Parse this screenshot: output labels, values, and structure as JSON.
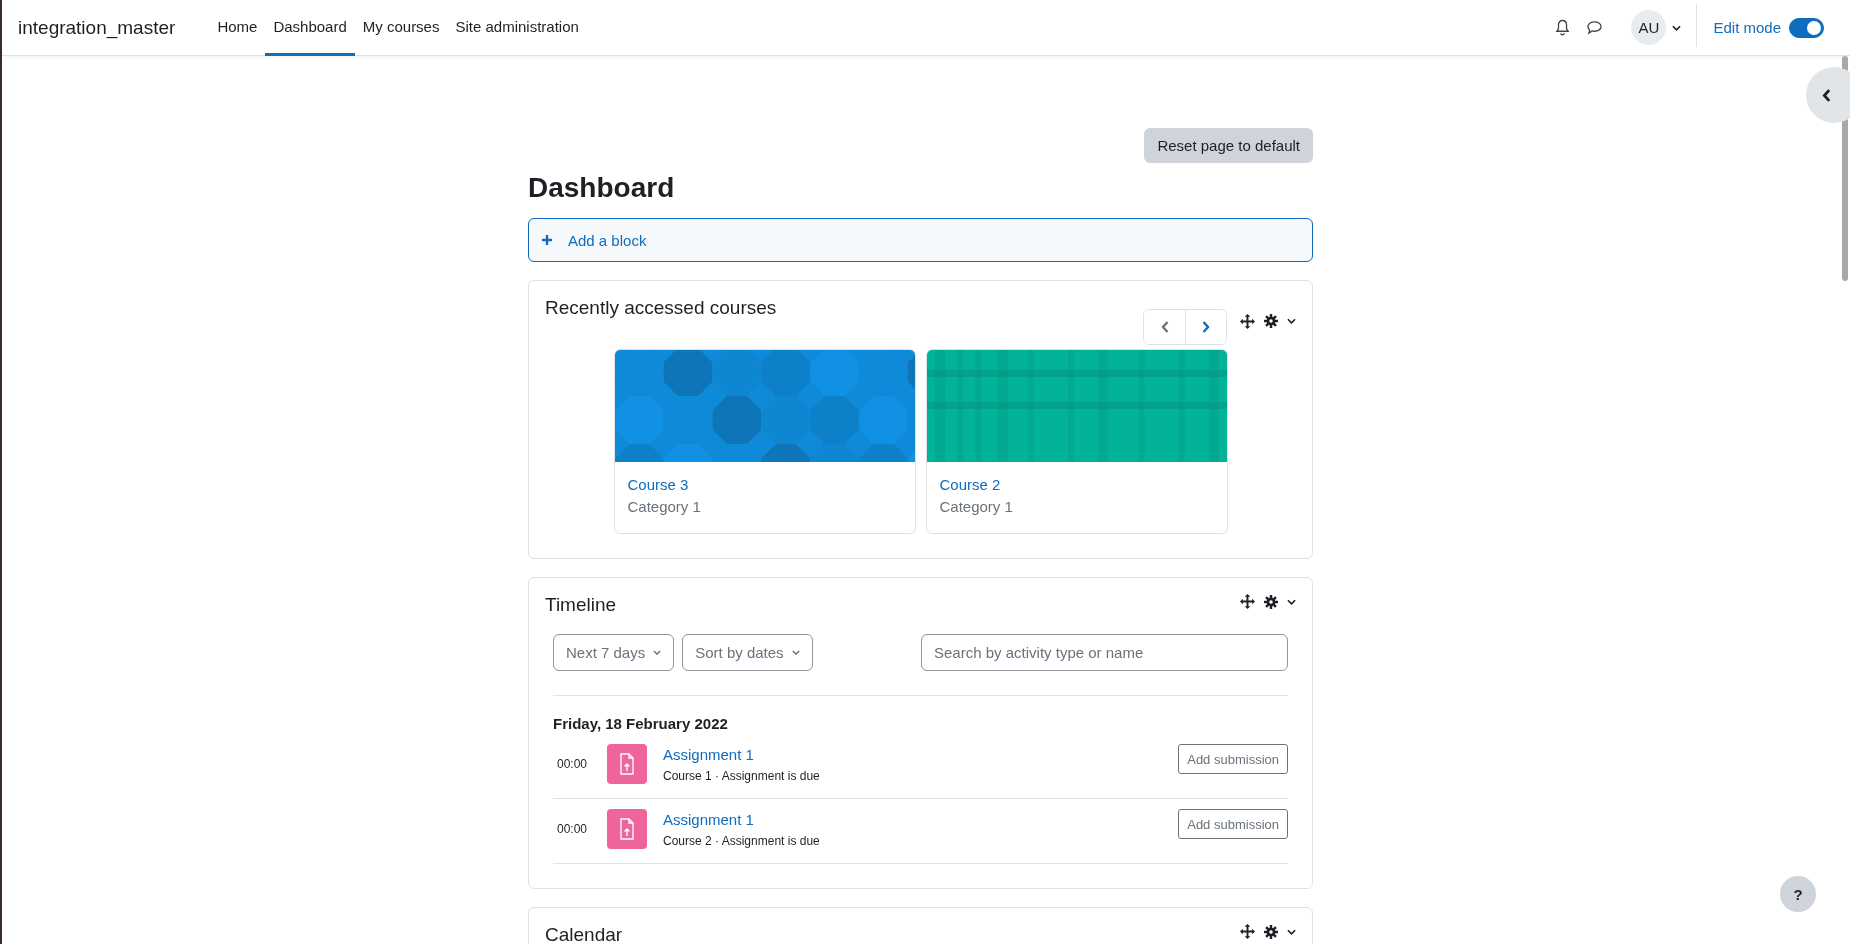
{
  "navbar": {
    "brand": "integration_master",
    "items": [
      {
        "label": "Home",
        "selected": false
      },
      {
        "label": "Dashboard",
        "selected": true
      },
      {
        "label": "My courses",
        "selected": false
      },
      {
        "label": "Site administration",
        "selected": false
      }
    ],
    "avatar": "AU",
    "edit_mode": {
      "label": "Edit mode",
      "on": true
    }
  },
  "page": {
    "reset_button": "Reset page to default",
    "title": "Dashboard",
    "add_block": "Add a block"
  },
  "recent_courses": {
    "title": "Recently accessed courses",
    "carousel": [
      {
        "kind": "prev",
        "disabled": true
      },
      {
        "kind": "next",
        "disabled": false
      }
    ],
    "courses": [
      {
        "name": "Course 3",
        "category": "Category 1",
        "kind": "octagons",
        "color": "#0f8ad8"
      },
      {
        "name": "Course 2",
        "category": "Category 1",
        "kind": "plaid",
        "color": "#02b39a"
      }
    ]
  },
  "timeline": {
    "title": "Timeline",
    "filters": [
      {
        "label": "Next 7 days"
      },
      {
        "label": "Sort by dates"
      }
    ],
    "search": {
      "placeholder": "Search by activity type or name"
    },
    "groups": [
      {
        "date": "Friday, 18 February 2022",
        "events": [
          {
            "time": "00:00",
            "name": "Assignment 1",
            "details": "Course 1 · Assignment is due",
            "action": "Add submission"
          },
          {
            "time": "00:00",
            "name": "Assignment 1",
            "details": "Course 2 · Assignment is due",
            "action": "Add submission"
          }
        ]
      }
    ]
  },
  "calendar": {
    "title": "Calendar"
  },
  "help_button": "?"
}
